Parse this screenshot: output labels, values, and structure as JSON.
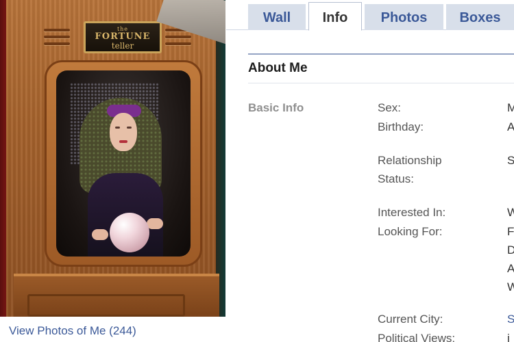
{
  "profile": {
    "photo_label": "profile-photo",
    "plaque": {
      "line1": "the",
      "line2": "FORTUNE",
      "line3": "teller"
    },
    "view_photos_link": "View Photos of Me (244)"
  },
  "tabs": [
    {
      "label": "Wall",
      "active": false
    },
    {
      "label": "Info",
      "active": true
    },
    {
      "label": "Photos",
      "active": false
    },
    {
      "label": "Boxes",
      "active": false
    }
  ],
  "section": {
    "title": "About Me"
  },
  "basic_info": {
    "group_label": "Basic Info",
    "fields": [
      {
        "label": "Sex:",
        "value": "M"
      },
      {
        "label": "Birthday:",
        "value": "A"
      },
      {
        "label": "Relationship\nStatus:",
        "value": "S"
      },
      {
        "label": "Interested In:",
        "value": "W"
      },
      {
        "label": "Looking For:",
        "value": "F\nD\nA\nW"
      },
      {
        "label": "Current City:",
        "value": "S"
      },
      {
        "label": "Political Views:",
        "value": "i"
      }
    ]
  },
  "colors": {
    "link": "#3b5998",
    "tab_bg": "#d8dfea",
    "header_rule": "#94a3c4",
    "muted_label": "#8f8f8f"
  }
}
